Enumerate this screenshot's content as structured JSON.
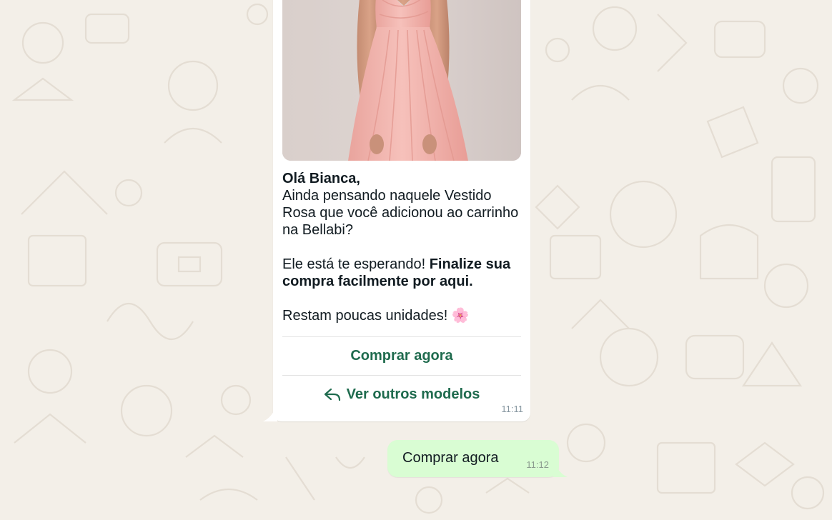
{
  "chat": {
    "incoming": {
      "greeting": "Olá Bianca,",
      "line1": "Ainda pensando naquele Vestido Rosa que você adicionou ao carrinho na Bellabi?",
      "line2_normal": "Ele está te esperando! ",
      "line2_bold": "Finalize sua compra facilmente por aqui.",
      "line3": "Restam poucas unidades! 🌸",
      "buttons": [
        {
          "label": "Comprar agora"
        },
        {
          "label": "Ver outros modelos",
          "icon": "reply-icon"
        }
      ],
      "time": "11:11"
    },
    "outgoing": {
      "text": "Comprar agora",
      "time": "11:12"
    }
  },
  "colors": {
    "wallpaper": "#f3efe8",
    "incoming_bubble": "#ffffff",
    "outgoing_bubble": "#d9fdd3",
    "button_text": "#1f6b4e",
    "dress": "#f2b3ad"
  }
}
